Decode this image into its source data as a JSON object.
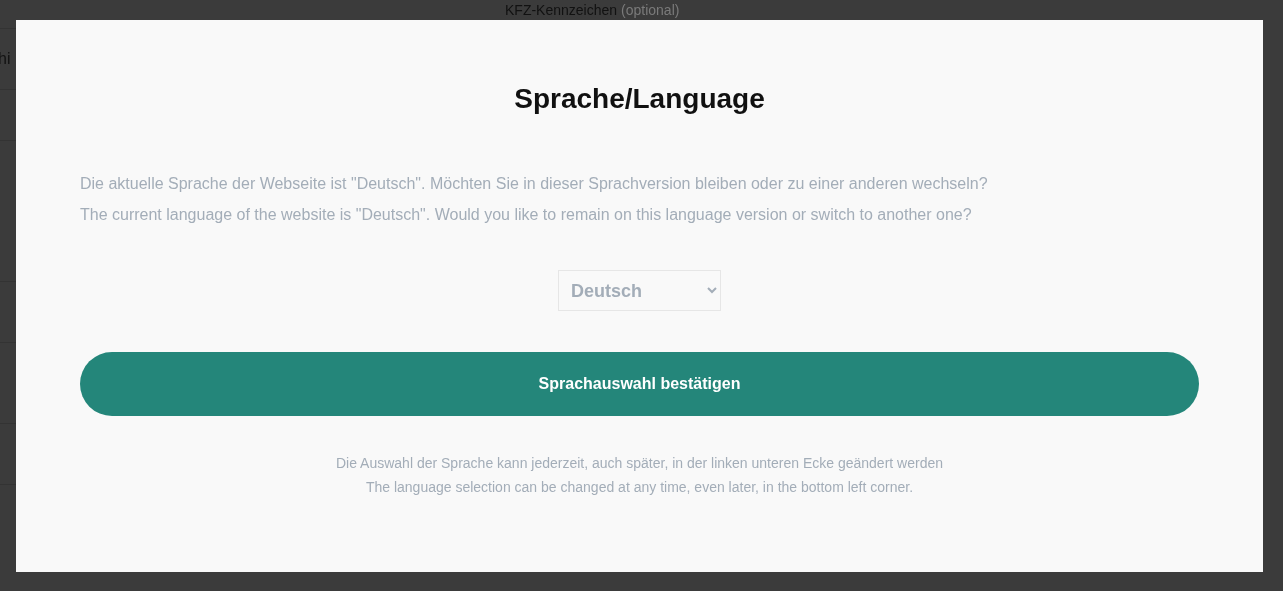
{
  "background_page": {
    "field_label": "KFZ-Kennzeichen",
    "field_hint": "(optional)",
    "cell_text": "hi"
  },
  "dialog": {
    "title": "Sprache/Language",
    "paragraphs": [
      "Die aktuelle Sprache der Webseite ist \"Deutsch\". Möchten Sie in dieser Sprachversion bleiben oder zu einer anderen wechseln?",
      "The current language of the website is \"Deutsch\". Would you like to remain on this language version or switch to another one?"
    ],
    "language_select": {
      "value": "Deutsch"
    },
    "confirm_button": "Sprachauswahl bestätigen",
    "notes": [
      "Die Auswahl der Sprache kann jederzeit, auch später, in der linken unteren Ecke geändert werden",
      "The language selection can be changed at any time, even later, in the bottom left corner."
    ]
  }
}
